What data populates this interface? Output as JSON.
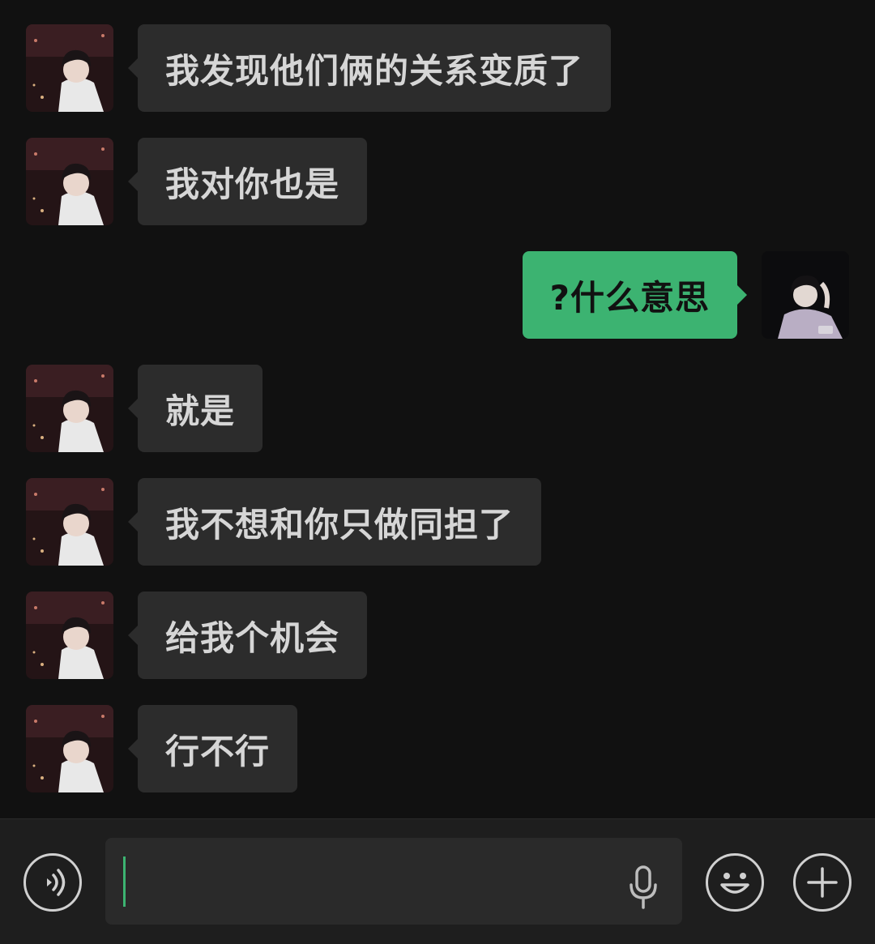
{
  "conversation": {
    "messages": [
      {
        "direction": "in",
        "text": "我发现他们俩的关系变质了"
      },
      {
        "direction": "in",
        "text": "我对你也是"
      },
      {
        "direction": "out",
        "text": "?什么意思"
      },
      {
        "direction": "in",
        "text": "就是"
      },
      {
        "direction": "in",
        "text": "我不想和你只做同担了"
      },
      {
        "direction": "in",
        "text": "给我个机会"
      },
      {
        "direction": "in",
        "text": "行不行"
      }
    ]
  },
  "input_bar": {
    "text_value": "",
    "icons": {
      "voice": "voice-mode-icon",
      "mic": "microphone-icon",
      "emoji": "emoji-icon",
      "more": "plus-icon"
    }
  },
  "colors": {
    "background": "#111111",
    "incoming_bubble": "#2c2c2c",
    "outgoing_bubble": "#3cb371",
    "input_bar": "#1e1e1e"
  }
}
